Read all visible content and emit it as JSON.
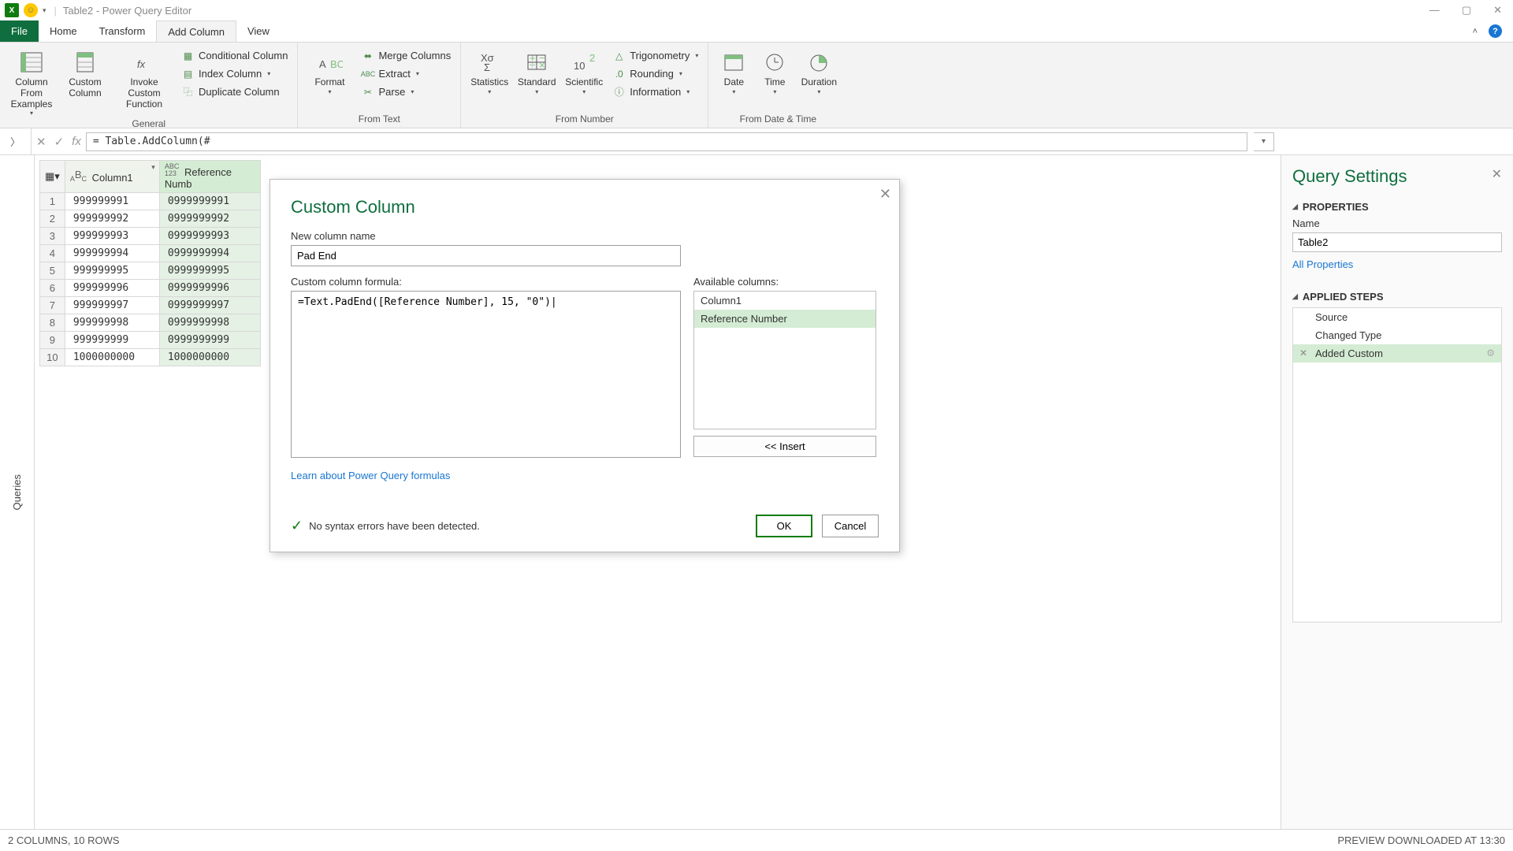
{
  "titlebar": {
    "text": "Table2 - Power Query Editor"
  },
  "tabs": {
    "file": "File",
    "home": "Home",
    "transform": "Transform",
    "add_column": "Add Column",
    "view": "View"
  },
  "ribbon": {
    "general": {
      "label": "General",
      "col_from_examples": "Column From Examples",
      "custom_column": "Custom Column",
      "invoke_custom_function": "Invoke Custom Function",
      "conditional_column": "Conditional Column",
      "index_column": "Index Column",
      "duplicate_column": "Duplicate Column"
    },
    "from_text": {
      "label": "From Text",
      "format": "Format",
      "merge_columns": "Merge Columns",
      "extract": "Extract",
      "parse": "Parse"
    },
    "from_number": {
      "label": "From Number",
      "statistics": "Statistics",
      "standard": "Standard",
      "scientific": "Scientific",
      "trigonometry": "Trigonometry",
      "rounding": "Rounding",
      "information": "Information"
    },
    "from_datetime": {
      "label": "From Date & Time",
      "date": "Date",
      "time": "Time",
      "duration": "Duration"
    }
  },
  "formula_bar": {
    "text": "= Table.AddColumn(#"
  },
  "queries_rail": {
    "label": "Queries"
  },
  "grid": {
    "columns": [
      "Column1",
      "Reference Numb"
    ],
    "rows": [
      {
        "n": "1",
        "c1": "999999991",
        "c2": "0999999991"
      },
      {
        "n": "2",
        "c1": "999999992",
        "c2": "0999999992"
      },
      {
        "n": "3",
        "c1": "999999993",
        "c2": "0999999993"
      },
      {
        "n": "4",
        "c1": "999999994",
        "c2": "0999999994"
      },
      {
        "n": "5",
        "c1": "999999995",
        "c2": "0999999995"
      },
      {
        "n": "6",
        "c1": "999999996",
        "c2": "0999999996"
      },
      {
        "n": "7",
        "c1": "999999997",
        "c2": "0999999997"
      },
      {
        "n": "8",
        "c1": "999999998",
        "c2": "0999999998"
      },
      {
        "n": "9",
        "c1": "999999999",
        "c2": "0999999999"
      },
      {
        "n": "10",
        "c1": "1000000000",
        "c2": "1000000000"
      }
    ]
  },
  "dialog": {
    "title": "Custom Column",
    "name_label": "New column name",
    "name_value": "Pad End",
    "formula_label": "Custom column formula:",
    "formula_value": "=Text.PadEnd([Reference Number], 15, \"0\")|",
    "avail_label": "Available columns:",
    "avail_cols": [
      "Column1",
      "Reference Number"
    ],
    "insert": "<< Insert",
    "learn": "Learn about Power Query formulas",
    "validate": "No syntax errors have been detected.",
    "ok": "OK",
    "cancel": "Cancel"
  },
  "settings": {
    "title": "Query Settings",
    "properties": "PROPERTIES",
    "name_label": "Name",
    "name_value": "Table2",
    "all_props": "All Properties",
    "applied_steps": "APPLIED STEPS",
    "steps": [
      "Source",
      "Changed Type",
      "Added Custom"
    ]
  },
  "statusbar": {
    "left": "2 COLUMNS, 10 ROWS",
    "right": "PREVIEW DOWNLOADED AT 13:30"
  }
}
